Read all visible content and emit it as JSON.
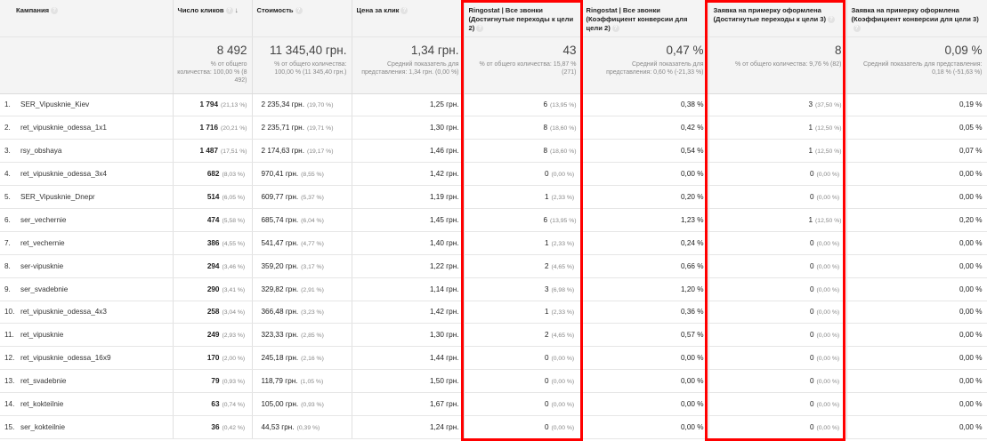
{
  "columns": [
    {
      "label": "Кампания",
      "help": "?"
    },
    {
      "label": "Число кликов",
      "help": "?",
      "sort": "↓"
    },
    {
      "label": "Стоимость",
      "help": "?"
    },
    {
      "label": "Цена за клик",
      "help": "?"
    },
    {
      "label": "Ringostat | Все звонки (Достигнутые переходы к цели 2)",
      "help": "?"
    },
    {
      "label": "Ringostat | Все звонки (Коэффициент конверсии для цели 2)",
      "help": "?"
    },
    {
      "label": "Заявка на примерку оформлена (Достигнутые переходы к цели 3)",
      "help": "?"
    },
    {
      "label": "Заявка на примерку оформлена (Коэффициент конверсии для цели 3)",
      "help": "?"
    }
  ],
  "totals": {
    "clicks": {
      "value": "8 492",
      "sub": "% от общего количества: 100,00 % (8 492)"
    },
    "cost": {
      "value": "11 345,40 грн.",
      "sub": "% от общего количества: 100,00 % (11 345,40 грн.)"
    },
    "cpc": {
      "value": "1,34 грн.",
      "sub": "Средний показатель для представления: 1,34 грн. (0,00 %)"
    },
    "goal2": {
      "value": "43",
      "sub": "% от общего количества: 15,87 % (271)"
    },
    "conv2": {
      "value": "0,47 %",
      "sub": "Средний показатель для представления: 0,60 % (-21,33 %)"
    },
    "goal3": {
      "value": "8",
      "sub": "% от общего количества: 9,76 % (82)"
    },
    "conv3": {
      "value": "0,09 %",
      "sub": "Средний показатель для представления: 0,18 % (-51,63 %)"
    }
  },
  "rows": [
    {
      "idx": "1.",
      "campaign": "SER_Vipusknie_Kiev",
      "clicks": "1 794",
      "clicks_pct": "(21,13 %)",
      "cost": "2 235,34 грн.",
      "cost_pct": "(19,70 %)",
      "cpc": "1,25 грн.",
      "goal2": "6",
      "goal2_pct": "(13,95 %)",
      "conv2": "0,38 %",
      "goal3": "3",
      "goal3_pct": "(37,50 %)",
      "conv3": "0,19 %"
    },
    {
      "idx": "2.",
      "campaign": "ret_vipusknie_odessa_1x1",
      "clicks": "1 716",
      "clicks_pct": "(20,21 %)",
      "cost": "2 235,71 грн.",
      "cost_pct": "(19,71 %)",
      "cpc": "1,30 грн.",
      "goal2": "8",
      "goal2_pct": "(18,60 %)",
      "conv2": "0,42 %",
      "goal3": "1",
      "goal3_pct": "(12,50 %)",
      "conv3": "0,05 %"
    },
    {
      "idx": "3.",
      "campaign": "rsy_obshaya",
      "clicks": "1 487",
      "clicks_pct": "(17,51 %)",
      "cost": "2 174,63 грн.",
      "cost_pct": "(19,17 %)",
      "cpc": "1,46 грн.",
      "goal2": "8",
      "goal2_pct": "(18,60 %)",
      "conv2": "0,54 %",
      "goal3": "1",
      "goal3_pct": "(12,50 %)",
      "conv3": "0,07 %"
    },
    {
      "idx": "4.",
      "campaign": "ret_vipusknie_odessa_3x4",
      "clicks": "682",
      "clicks_pct": "(8,03 %)",
      "cost": "970,41 грн.",
      "cost_pct": "(8,55 %)",
      "cpc": "1,42 грн.",
      "goal2": "0",
      "goal2_pct": "(0,00 %)",
      "conv2": "0,00 %",
      "goal3": "0",
      "goal3_pct": "(0,00 %)",
      "conv3": "0,00 %"
    },
    {
      "idx": "5.",
      "campaign": "SER_Vipusknie_Dnepr",
      "clicks": "514",
      "clicks_pct": "(6,05 %)",
      "cost": "609,77 грн.",
      "cost_pct": "(5,37 %)",
      "cpc": "1,19 грн.",
      "goal2": "1",
      "goal2_pct": "(2,33 %)",
      "conv2": "0,20 %",
      "goal3": "0",
      "goal3_pct": "(0,00 %)",
      "conv3": "0,00 %"
    },
    {
      "idx": "6.",
      "campaign": "ser_vechernie",
      "clicks": "474",
      "clicks_pct": "(5,58 %)",
      "cost": "685,74 грн.",
      "cost_pct": "(6,04 %)",
      "cpc": "1,45 грн.",
      "goal2": "6",
      "goal2_pct": "(13,95 %)",
      "conv2": "1,23 %",
      "goal3": "1",
      "goal3_pct": "(12,50 %)",
      "conv3": "0,20 %"
    },
    {
      "idx": "7.",
      "campaign": "ret_vechernie",
      "clicks": "386",
      "clicks_pct": "(4,55 %)",
      "cost": "541,47 грн.",
      "cost_pct": "(4,77 %)",
      "cpc": "1,40 грн.",
      "goal2": "1",
      "goal2_pct": "(2,33 %)",
      "conv2": "0,24 %",
      "goal3": "0",
      "goal3_pct": "(0,00 %)",
      "conv3": "0,00 %"
    },
    {
      "idx": "8.",
      "campaign": "ser-vipusknie",
      "clicks": "294",
      "clicks_pct": "(3,46 %)",
      "cost": "359,20 грн.",
      "cost_pct": "(3,17 %)",
      "cpc": "1,22 грн.",
      "goal2": "2",
      "goal2_pct": "(4,65 %)",
      "conv2": "0,66 %",
      "goal3": "0",
      "goal3_pct": "(0,00 %)",
      "conv3": "0,00 %"
    },
    {
      "idx": "9.",
      "campaign": "ser_svadebnie",
      "clicks": "290",
      "clicks_pct": "(3,41 %)",
      "cost": "329,82 грн.",
      "cost_pct": "(2,91 %)",
      "cpc": "1,14 грн.",
      "goal2": "3",
      "goal2_pct": "(6,98 %)",
      "conv2": "1,20 %",
      "goal3": "0",
      "goal3_pct": "(0,00 %)",
      "conv3": "0,00 %"
    },
    {
      "idx": "10.",
      "campaign": "ret_vipusknie_odessa_4x3",
      "clicks": "258",
      "clicks_pct": "(3,04 %)",
      "cost": "366,48 грн.",
      "cost_pct": "(3,23 %)",
      "cpc": "1,42 грн.",
      "goal2": "1",
      "goal2_pct": "(2,33 %)",
      "conv2": "0,36 %",
      "goal3": "0",
      "goal3_pct": "(0,00 %)",
      "conv3": "0,00 %"
    },
    {
      "idx": "11.",
      "campaign": "ret_vipusknie",
      "clicks": "249",
      "clicks_pct": "(2,93 %)",
      "cost": "323,33 грн.",
      "cost_pct": "(2,85 %)",
      "cpc": "1,30 грн.",
      "goal2": "2",
      "goal2_pct": "(4,65 %)",
      "conv2": "0,57 %",
      "goal3": "0",
      "goal3_pct": "(0,00 %)",
      "conv3": "0,00 %"
    },
    {
      "idx": "12.",
      "campaign": "ret_vipusknie_odessa_16x9",
      "clicks": "170",
      "clicks_pct": "(2,00 %)",
      "cost": "245,18 грн.",
      "cost_pct": "(2,16 %)",
      "cpc": "1,44 грн.",
      "goal2": "0",
      "goal2_pct": "(0,00 %)",
      "conv2": "0,00 %",
      "goal3": "0",
      "goal3_pct": "(0,00 %)",
      "conv3": "0,00 %"
    },
    {
      "idx": "13.",
      "campaign": "ret_svadebnie",
      "clicks": "79",
      "clicks_pct": "(0,93 %)",
      "cost": "118,79 грн.",
      "cost_pct": "(1,05 %)",
      "cpc": "1,50 грн.",
      "goal2": "0",
      "goal2_pct": "(0,00 %)",
      "conv2": "0,00 %",
      "goal3": "0",
      "goal3_pct": "(0,00 %)",
      "conv3": "0,00 %"
    },
    {
      "idx": "14.",
      "campaign": "ret_kokteilnie",
      "clicks": "63",
      "clicks_pct": "(0,74 %)",
      "cost": "105,00 грн.",
      "cost_pct": "(0,93 %)",
      "cpc": "1,67 грн.",
      "goal2": "0",
      "goal2_pct": "(0,00 %)",
      "conv2": "0,00 %",
      "goal3": "0",
      "goal3_pct": "(0,00 %)",
      "conv3": "0,00 %"
    },
    {
      "idx": "15.",
      "campaign": "ser_kokteilnie",
      "clicks": "36",
      "clicks_pct": "(0,42 %)",
      "cost": "44,53 грн.",
      "cost_pct": "(0,39 %)",
      "cpc": "1,24 грн.",
      "goal2": "0",
      "goal2_pct": "(0,00 %)",
      "conv2": "0,00 %",
      "goal3": "0",
      "goal3_pct": "(0,00 %)",
      "conv3": "0,00 %"
    }
  ],
  "highlight_color": "#ff0000"
}
